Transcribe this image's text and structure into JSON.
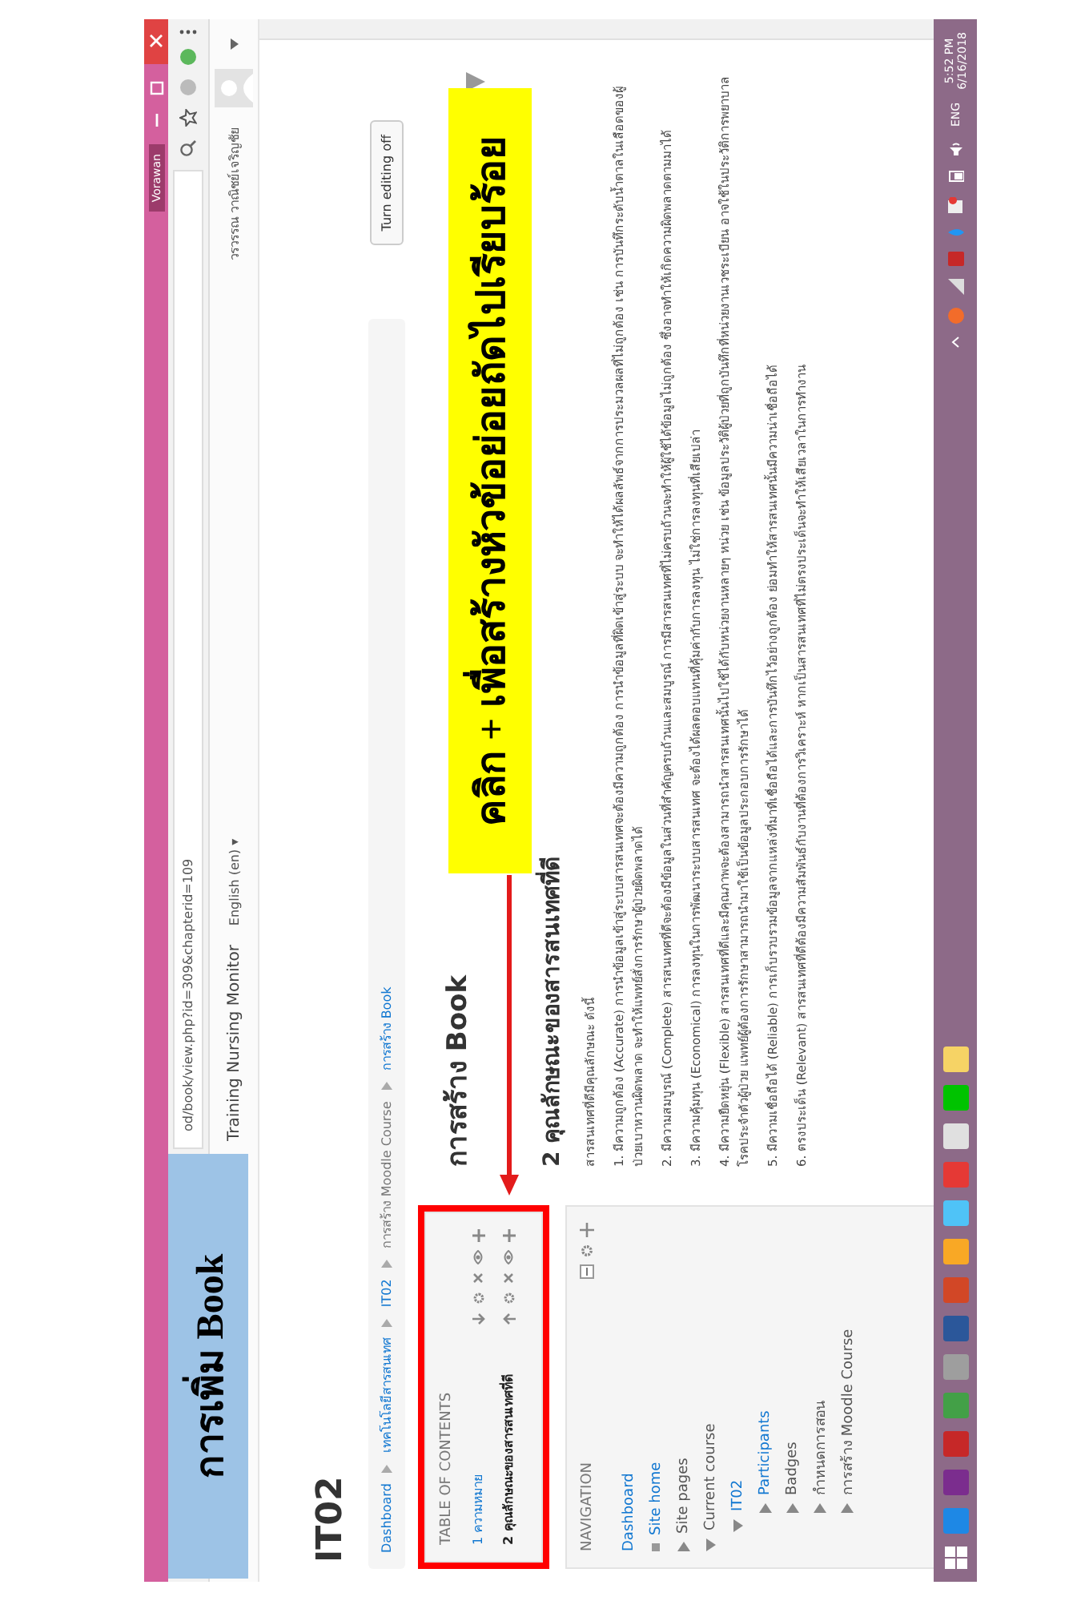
{
  "annotations": {
    "title_label": "การเพิ่ม Book",
    "callout": "คลิก + เพื่อสร้างหัวข้อย่อยถัดไปเรียบร้อย"
  },
  "browser": {
    "profile": "Vorawan",
    "url": "od/book/view.php?id=309&chapterid=109"
  },
  "site_header": {
    "site_name": "Training Nursing Monitor",
    "language": "English (en) ▾",
    "user_name": "วรวรรณ วาณิชย์เจริญชัย"
  },
  "page": {
    "title": "IT02",
    "edit_button": "Turn editing off",
    "breadcrumb": [
      {
        "label": "Dashboard",
        "link": true
      },
      {
        "label": "เทคโนโลยีสารสนเทศ",
        "link": true
      },
      {
        "label": "IT02",
        "link": true
      },
      {
        "label": "การสร้าง Moodle Course",
        "link": false
      },
      {
        "label": "การสร้าง Book",
        "link": true
      }
    ]
  },
  "toc": {
    "title": "TABLE OF CONTENTS",
    "chapters": [
      {
        "label": "1 ความหมาย",
        "selected": false
      },
      {
        "label": "2 คุณลักษณะของสารสนเทศที่ดี",
        "selected": true
      }
    ]
  },
  "navigation": {
    "title": "NAVIGATION",
    "items": [
      {
        "label": "Dashboard",
        "kind": "plain",
        "link": true
      },
      {
        "label": "Site home",
        "kind": "bullet",
        "link": true
      },
      {
        "label": "Site pages",
        "kind": "branch",
        "link": false,
        "expanded": false
      },
      {
        "label": "Current course",
        "kind": "branch",
        "link": false,
        "expanded": true,
        "children": [
          {
            "label": "IT02",
            "kind": "branch",
            "link": true,
            "expanded": true,
            "children": [
              {
                "label": "Participants",
                "kind": "branch",
                "link": true,
                "expanded": false
              },
              {
                "label": "Badges",
                "kind": "branch",
                "link": false,
                "expanded": false
              },
              {
                "label": "กำหนดการสอน",
                "kind": "branch",
                "link": false,
                "expanded": false
              },
              {
                "label": "การสร้าง Moodle Course",
                "kind": "branch",
                "link": false,
                "expanded": false
              }
            ]
          }
        ]
      }
    ]
  },
  "chapter": {
    "heading": "การสร้าง Book",
    "subheading": "2 คุณลักษณะของสารสนเทศที่ดี",
    "intro": "สารสนเทศที่ดีมีคุณลักษณะ ดังนี้",
    "items": [
      "1. มีความถูกต้อง (Accurate) การนำข้อมูลเข้าสู่ระบบสารสนเทศจะต้องมีความถูกต้อง การนำข้อมูลที่ผิดเข้าสู่ระบบ จะทำให้ได้ผลลัพธ์จากการประมวลผลที่ไม่ถูกต้อง เช่น การบันทึกระดับน้ำตาลในเลือดของผู้ป่วยเบาหวานผิดพลาด จะทำให้แพทย์สั่งการรักษาผู้ป่วยผิดพลาดได้",
      "2. มีความสมบูรณ์ (Complete) สารสนเทศที่ดีจะต้องมีข้อมูลในส่วนที่สำคัญครบถ้วนและสมบูรณ์ การมีสารสนเทศที่ไม่ครบถ้วนจะทำให้ผู้ใช้ได้ข้อมูลไม่ถูกต้อง ซึ่งอาจทำให้เกิดความผิดพลาดตามมาได้",
      "3. มีความคุ้มทุน (Economical) การลงทุนในการพัฒนาระบบสารสนเทศ จะต้องได้ผลตอบแทนที่คุ้มค่ากับการลงทุน ไม่ใช่การลงทุนที่เสียเปล่า",
      "4. มีความยืดหยุ่น (Flexible) สารสนเทศที่ดีและมีคุณภาพจะต้องสามารถนำสารสนเทศนั้นไปใช้ได้กับหน่วยงานหลายๆ หน่วย เช่น ข้อมูลประวัติผู้ป่วยที่ถูกบันทึกที่หน่วยงานเวชระเบียน อาจใช้ในประวัติการพยาบาล โรคประจำตัวผู้ป่วย แพทย์ผู้ต้องการรักษาสามารถนำมาใช้เป็นข้อมูลประกอบการรักษาได้",
      "5. มีความเชื่อถือได้ (Reliable) การเก็บรวบรวมข้อมูลจากแหล่งที่มาที่เชื่อถือได้และการบันทึกไว้อย่างถูกต้อง ย่อมทำให้สารสนเทศนั้นมีความน่าเชื่อถือได้",
      "6. ตรงประเด็น (Relevant) สารสนเทศที่ดีต้องมีความสัมพันธ์กับงานที่ต้องการวิเคราะห์ หากเป็นสารสนเทศที่ไม่ตรงประเด็นจะทำให้เสียเวลาในการทำงาน"
    ]
  },
  "taskbar": {
    "language": "ENG",
    "time": "5:52 PM",
    "date": "6/16/2018"
  }
}
